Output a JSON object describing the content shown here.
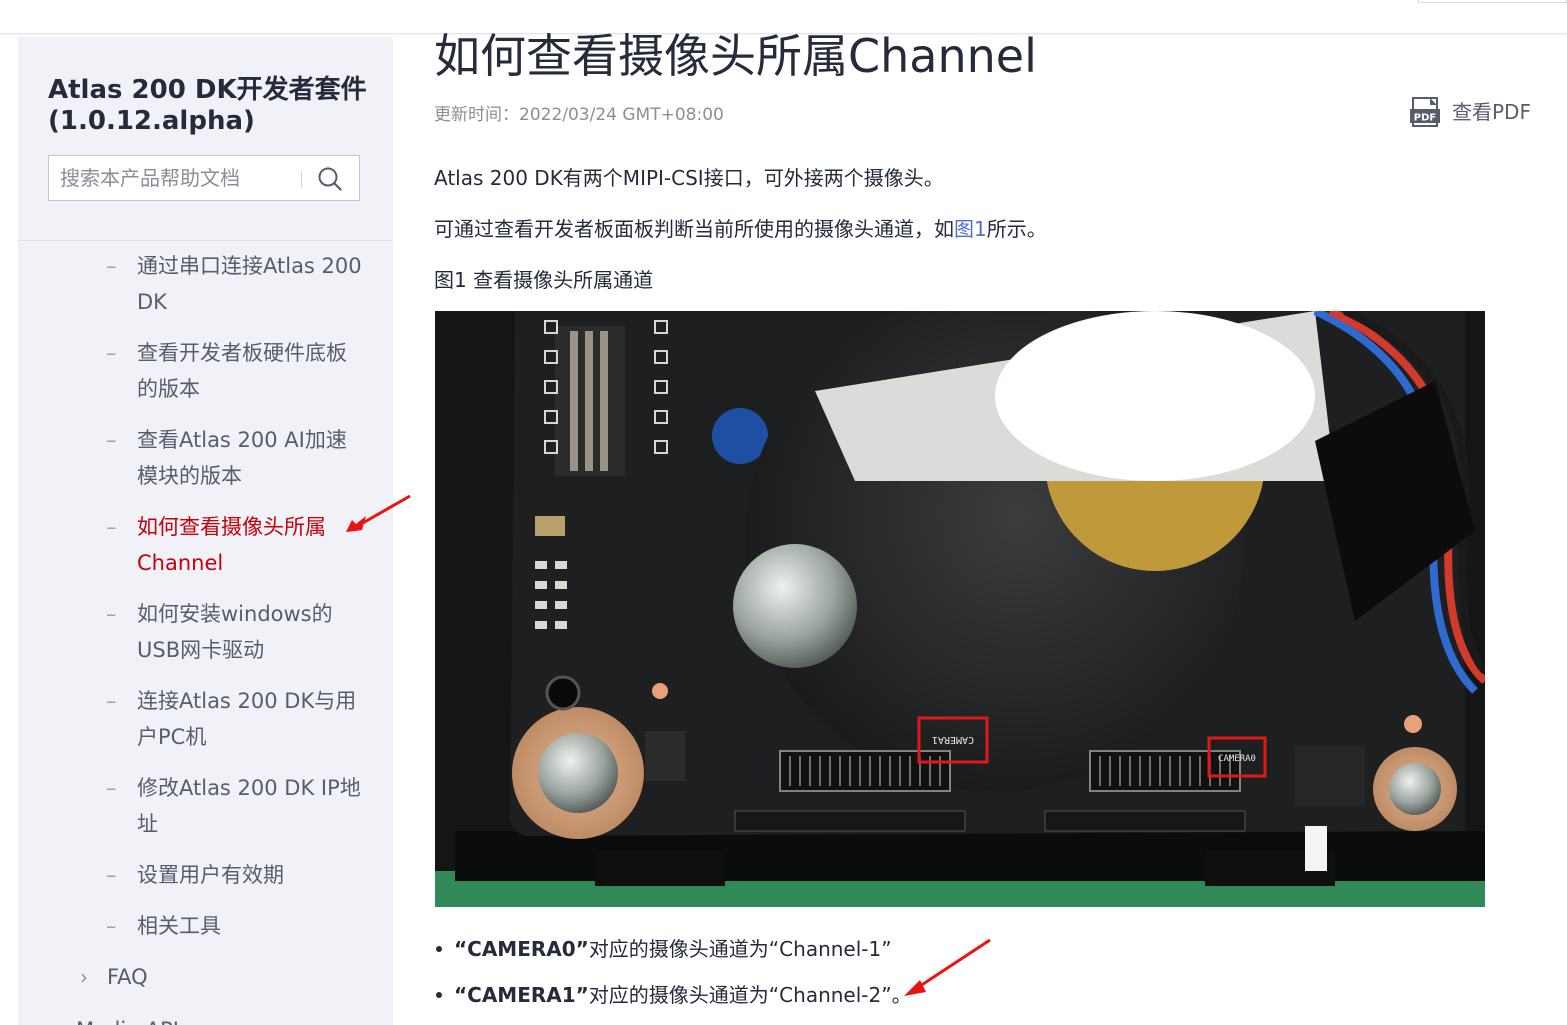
{
  "sidebar": {
    "title": "Atlas 200 DK开发者套件(1.0.12.alpha)",
    "search": {
      "placeholder": "搜索本产品帮助文档"
    },
    "items": [
      {
        "dash": "–",
        "label": "通过串口连接Atlas 200 DK"
      },
      {
        "dash": "–",
        "label": "查看开发者板硬件底板的版本"
      },
      {
        "dash": "–",
        "label": "查看Atlas 200 AI加速模块的版本"
      },
      {
        "dash": "–",
        "label": "如何查看摄像头所属Channel"
      },
      {
        "dash": "–",
        "label": "如何安装windows的USB网卡驱动"
      },
      {
        "dash": "–",
        "label": "连接Atlas 200 DK与用户PC机"
      },
      {
        "dash": "–",
        "label": "修改Atlas 200 DK IP地址"
      },
      {
        "dash": "–",
        "label": "设置用户有效期"
      },
      {
        "dash": "–",
        "label": "相关工具"
      }
    ],
    "faq_label": "FAQ",
    "next_label": "Media API"
  },
  "article": {
    "title": "如何查看摄像头所属Channel",
    "update_label": "更新时间：",
    "update_value": "2022/03/24 GMT+08:00",
    "pdf_label": "查看PDF",
    "para1": "Atlas 200 DK有两个MIPI-CSI接口，可外接两个摄像头。",
    "para2_before": "可通过查看开发者板面板判断当前所使用的摄像头通道，如",
    "para2_link": "图1",
    "para2_after": "所示。",
    "figure_caption": "图1 查看摄像头所属通道",
    "photo_labels": {
      "camera1": "CAMERA1",
      "camera0": "CAMERA0"
    },
    "bullets": [
      {
        "bold": "“CAMERA0”",
        "text": "对应的摄像头通道为“Channel-1”"
      },
      {
        "bold": "“CAMERA1”",
        "text": "对应的摄像头通道为“Channel-2”。"
      }
    ]
  },
  "colors": {
    "accent": "#c7000b",
    "link": "#526ecc",
    "sidebar_bg": "#f0f2f7"
  }
}
